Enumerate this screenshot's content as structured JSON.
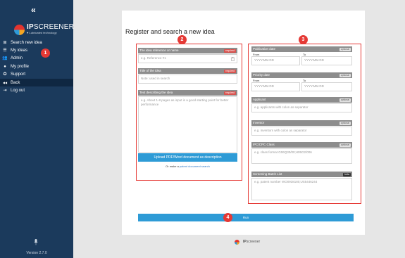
{
  "sidebar": {
    "collapse_glyph": "«",
    "logo": {
      "brand_bold": "IP",
      "brand_rest": "SCREENER",
      "tagline": "♥ Lubricated technology"
    },
    "items": [
      {
        "label": "Search new idea",
        "icon": "plus-square-icon",
        "glyph": "⊞"
      },
      {
        "label": "My ideas",
        "icon": "list-icon",
        "glyph": "☰"
      },
      {
        "label": "Admin",
        "icon": "users-icon",
        "glyph": "👥"
      },
      {
        "label": "My profile",
        "icon": "user-icon",
        "glyph": "●"
      },
      {
        "label": "Support",
        "icon": "lifebuoy-icon",
        "glyph": "✪"
      },
      {
        "label": "Back",
        "icon": "back-icon",
        "glyph": "◀◀"
      },
      {
        "label": "Log out",
        "icon": "logout-icon",
        "glyph": "⇥"
      }
    ],
    "version": "Version 2.7.0"
  },
  "main": {
    "title": "Register and search a new idea",
    "left": {
      "reference": {
        "label": "The idea reference or name",
        "badge": "required",
        "placeholder": "e.g. Reference #1"
      },
      "title": {
        "label": "Title of the idea",
        "badge": "required",
        "placeholder": "Note: used in search"
      },
      "text": {
        "label": "Text describing the idea",
        "badge": "required",
        "placeholder": "e.g. About 1-8 pages as input is a good starting point for better performance"
      },
      "upload_button": "Upload PDF/Word document as description",
      "patent_prefix": "Or make a ",
      "patent_link": "patent document search"
    },
    "right": {
      "publication_date": {
        "label": "Publication date",
        "badge": "optional",
        "from": "From",
        "to": "To",
        "from_placeholder": "YYYY.MM.DD",
        "to_placeholder": "YYYY.MM.DD"
      },
      "priority_date": {
        "label": "Priority date",
        "badge": "optional",
        "from": "From",
        "to": "To",
        "from_placeholder": "YYYY.MM.DD",
        "to_placeholder": "YYYY.MM.DD"
      },
      "applicant": {
        "label": "Applicant",
        "badge": "optional",
        "placeholder": "e.g. applicants with colon as separator"
      },
      "inventor": {
        "label": "Inventor",
        "badge": "optional",
        "placeholder": "e.g. inventors with colon as separator"
      },
      "ipc": {
        "label": "IPC/CPC Class",
        "badge": "optional",
        "placeholder": "e.g. class format G06Q30/00;H05G2/006"
      },
      "screening": {
        "label": "Screening Batch List",
        "badge": "beta",
        "placeholder": "e.g. patent number WO0938180;US5446244"
      }
    },
    "run_button": "Run"
  },
  "footer": {
    "brand_bold": "IP",
    "brand_rest": "screener"
  },
  "annotations": [
    "1",
    "2",
    "3",
    "4"
  ],
  "colors": {
    "sidebar": "#1b3a5c",
    "accent": "#2e9bd6",
    "annotation": "#e53935",
    "required": "#d9534f"
  }
}
